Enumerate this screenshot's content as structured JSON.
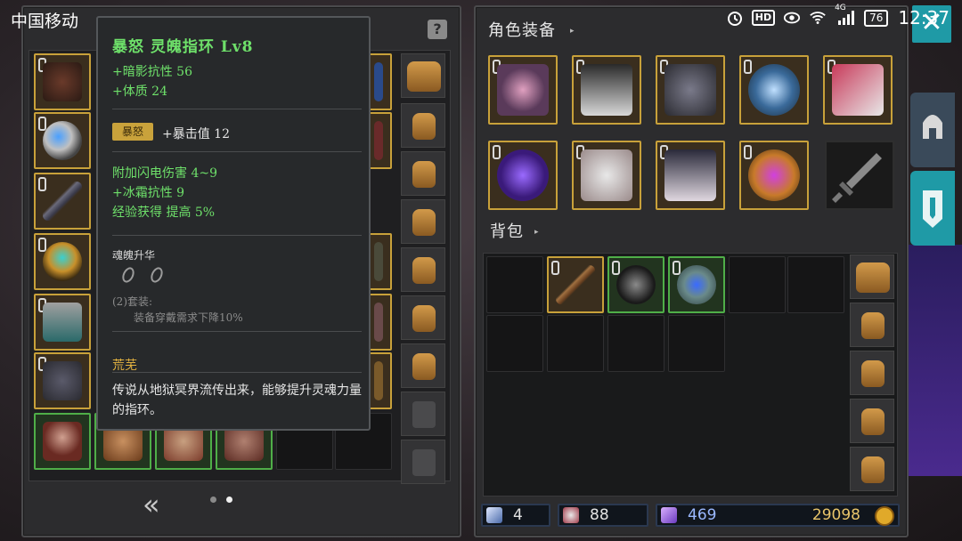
{
  "status_bar": {
    "carrier": "中国移动",
    "hd_label": "HD",
    "signal_label": "4G",
    "battery": "76",
    "time": "12:37"
  },
  "tooltip": {
    "title": "暴怒 灵魄指环 Lv8",
    "base_stats": [
      "+暗影抗性 56",
      "+体质 24"
    ],
    "tag": "暴怒",
    "tag_stat": "+暴击值 12",
    "extra_stats": [
      "附加闪电伤害 4~9",
      "+冰霜抗性 9",
      "经验获得 提高 5%"
    ],
    "soul_label": "魂魄升华",
    "set_count": "(2)套装:",
    "set_bonus": "装备穿戴需求下降10%",
    "set_name": "荒芜",
    "description": "传说从地狱冥界流传出来，能够提升灵魂力量的指环。"
  },
  "left_panel": {
    "help_label": "?",
    "pager_label": "«",
    "page_index": 2,
    "page_count": 2
  },
  "right_panel": {
    "equipment_title": "角色装备",
    "bag_title": "背包",
    "stats": {
      "wand_count": "4",
      "potion_count": "88",
      "gem_count": "469",
      "gold": "29098"
    }
  },
  "side": {
    "close_label": "✕"
  },
  "colors": {
    "accent_teal": "#1f9aa6",
    "gold_border": "#c8a13a",
    "green_border": "#4fae48",
    "stat_green": "#6ee06a"
  }
}
